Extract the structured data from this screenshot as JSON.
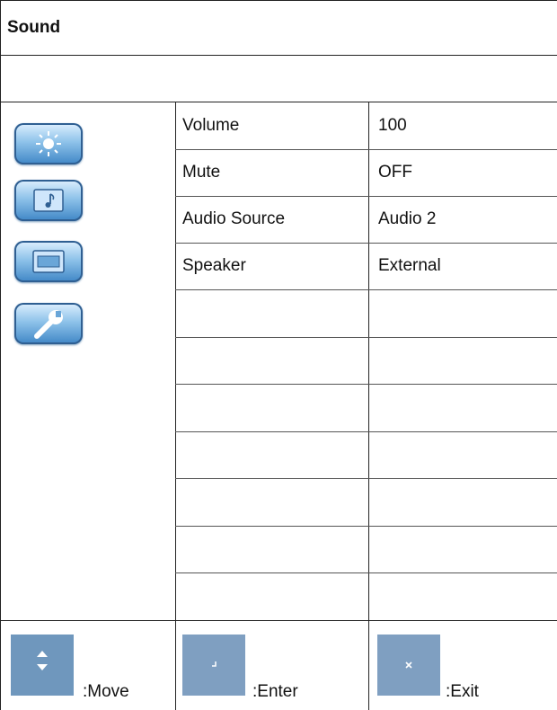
{
  "header": {
    "title": "Sound"
  },
  "menu_icons": [
    {
      "name": "brightness-icon"
    },
    {
      "name": "music-note-icon"
    },
    {
      "name": "screen-icon"
    },
    {
      "name": "wrench-icon"
    }
  ],
  "settings": [
    {
      "label": "Volume",
      "value": "100"
    },
    {
      "label": "Mute",
      "value": "OFF"
    },
    {
      "label": "Audio Source",
      "value": "Audio 2"
    },
    {
      "label": "Speaker",
      "value": "External"
    }
  ],
  "footer": {
    "move_label": ":Move",
    "enter_label": ":Enter",
    "exit_label": ":Exit",
    "move_icon": "up-down-arrow-icon",
    "enter_icon": "enter-icon",
    "exit_icon": "close-icon"
  }
}
